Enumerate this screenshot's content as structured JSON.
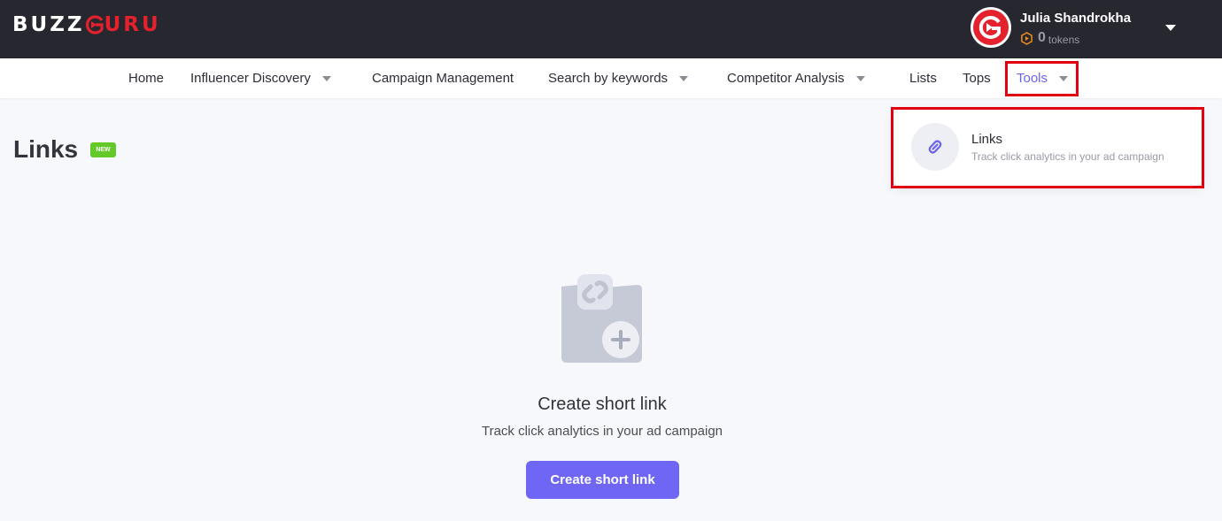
{
  "brand": {
    "logo_left": "BUZZ",
    "logo_right": "URU"
  },
  "user": {
    "name": "Julia Shandrokha",
    "tokens_count": "0",
    "tokens_unit": "tokens"
  },
  "nav": {
    "items": [
      {
        "label": "Home"
      },
      {
        "label": "Influencer Discovery"
      },
      {
        "label": "Campaign Management"
      },
      {
        "label": "Search by keywords"
      },
      {
        "label": "Competitor Analysis"
      },
      {
        "label": "Lists"
      },
      {
        "label": "Tops"
      },
      {
        "label": "Tools"
      }
    ],
    "active": "Tools"
  },
  "page": {
    "title": "Links",
    "badge": "NEW"
  },
  "empty_state": {
    "title": "Create short link",
    "subtitle": "Track click analytics in your ad campaign",
    "button": "Create short link"
  },
  "tools_dropdown": {
    "items": [
      {
        "title": "Links",
        "description": "Track click analytics in your ad campaign",
        "icon": "link-icon"
      }
    ]
  },
  "colors": {
    "topbar": "#272730",
    "accent": "#6f66f6",
    "brand_red": "#e4212c",
    "badge_green": "#62c928",
    "highlight": "#e0000f"
  }
}
